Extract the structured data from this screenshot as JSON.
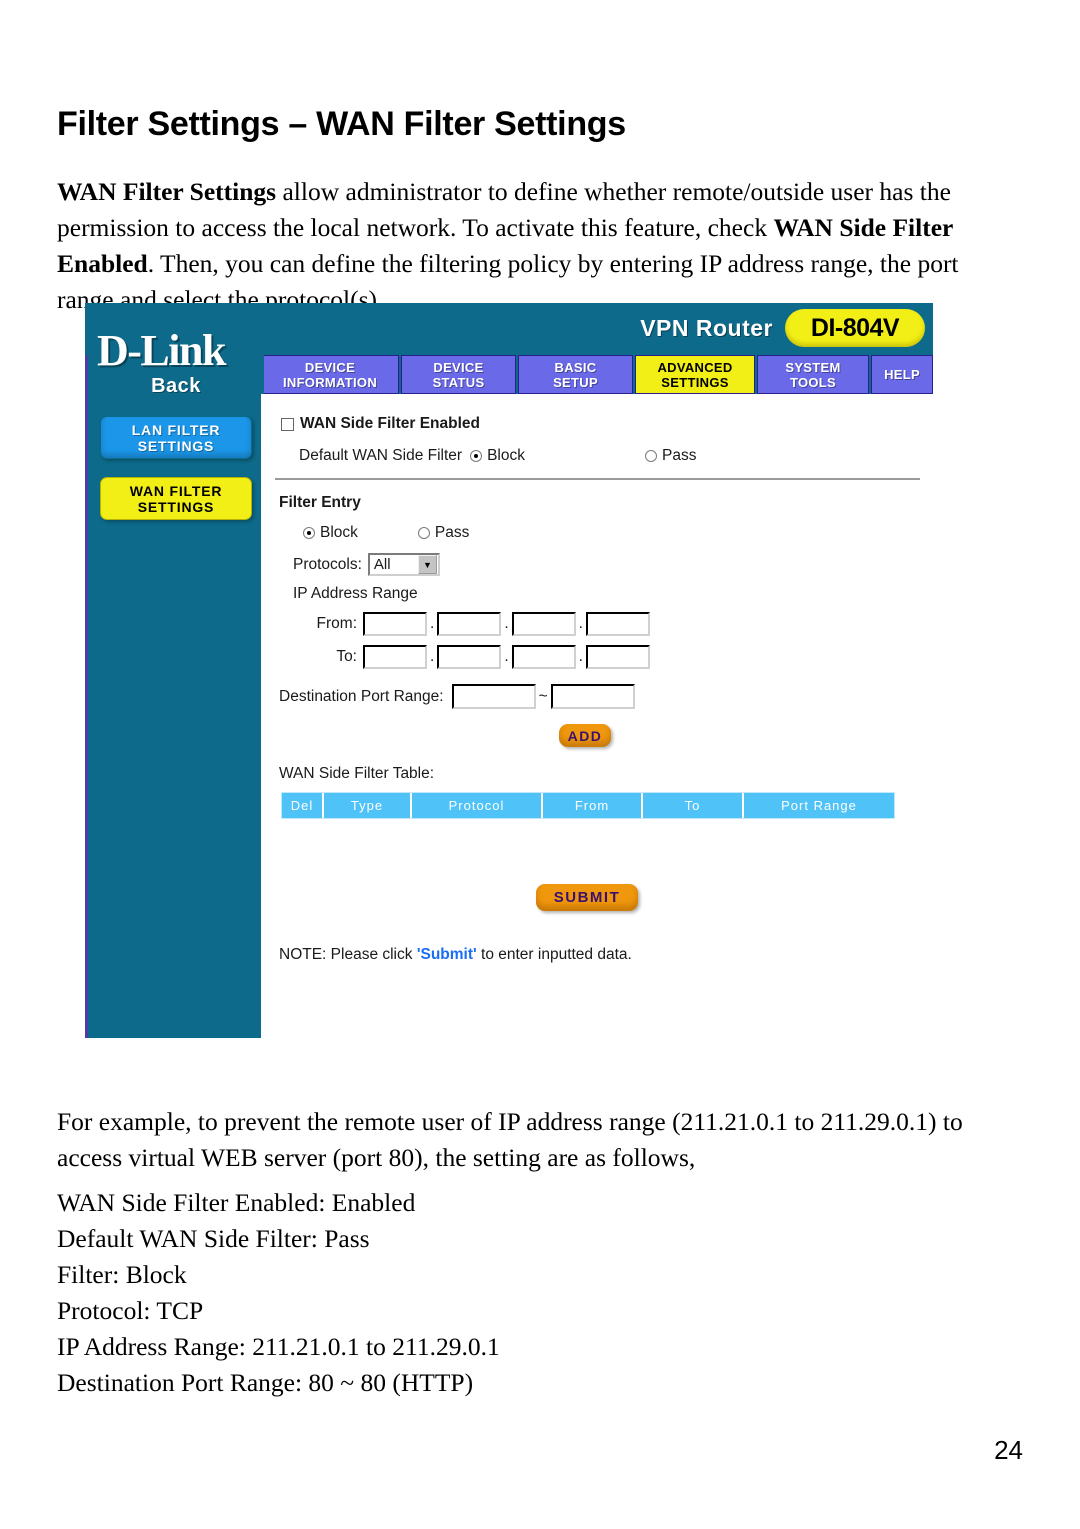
{
  "document": {
    "title": "Filter Settings – WAN Filter Settings",
    "intro": {
      "bold1": "WAN Filter Settings",
      "text1": " allow administrator to define whether remote/outside user has the permission to access the local network. To activate this feature, check ",
      "bold2": "WAN Side Filter Enabled",
      "text2": ". Then, you can define the filtering policy by entering IP address range, the port range and select the protocol(s)."
    },
    "example_paragraph": "For example, to prevent the remote user of IP address range (211.21.0.1 to 211.29.0.1) to access virtual WEB server (port 80), the setting are as follows,",
    "settings_summary": [
      "WAN Side Filter Enabled: Enabled",
      "Default WAN Side Filter: Pass",
      "Filter: Block",
      "Protocol: TCP",
      "IP Address Range: 211.21.0.1 to 211.29.0.1",
      "Destination Port Range: 80 ~ 80 (HTTP)"
    ],
    "page_number": "24"
  },
  "router_ui": {
    "header": {
      "brand": "D-Link",
      "product_label": "VPN Router",
      "model": "DI-804V"
    },
    "nav_tabs": [
      {
        "line1": "DEVICE",
        "line2": "INFORMATION",
        "active": false
      },
      {
        "line1": "DEVICE",
        "line2": "STATUS",
        "active": false
      },
      {
        "line1": "BASIC",
        "line2": "SETUP",
        "active": false
      },
      {
        "line1": "ADVANCED",
        "line2": "SETTINGS",
        "active": true
      },
      {
        "line1": "SYSTEM",
        "line2": "TOOLS",
        "active": false
      },
      {
        "line1": "HELP",
        "line2": "",
        "active": false
      }
    ],
    "sidebar": {
      "back_label": "Back",
      "buttons": [
        {
          "line1": "LAN FILTER",
          "line2": "SETTINGS",
          "style": "blue"
        },
        {
          "line1": "WAN FILTER",
          "line2": "SETTINGS",
          "style": "yellow"
        }
      ]
    },
    "form": {
      "enable_checkbox_label": "WAN Side Filter Enabled",
      "enable_checkbox_checked": false,
      "default_filter_label": "Default WAN Side Filter",
      "default_filter_block": "Block",
      "default_filter_pass": "Pass",
      "default_filter_selected": "Block",
      "filter_entry_title": "Filter Entry",
      "entry_block": "Block",
      "entry_pass": "Pass",
      "entry_selected": "Block",
      "protocols_label": "Protocols:",
      "protocols_value": "All",
      "ip_range_label": "IP Address Range",
      "from_label": "From:",
      "to_label": "To:",
      "from_octets": [
        "",
        "",
        "",
        ""
      ],
      "to_octets": [
        "",
        "",
        "",
        ""
      ],
      "dot": ".",
      "port_range_label": "Destination Port Range:",
      "port_from": "",
      "port_to": "",
      "port_separator": "~",
      "add_button": "ADD",
      "table_caption": "WAN Side Filter Table:",
      "table_headers": [
        "Del",
        "Type",
        "Protocol",
        "From",
        "To",
        "Port Range"
      ],
      "table_rows": [],
      "submit_button": "SUBMIT",
      "note_prefix": "NOTE: Please click ",
      "note_highlight": "'Submit'",
      "note_suffix": " to enter inputted data."
    },
    "colors": {
      "panel_teal": "#0d6a8a",
      "tab_blue": "#6a6ae8",
      "tab_active_yellow": "#f2ef16",
      "button_orange": "#f0980d",
      "button_text_purple": "#3b1070",
      "table_header_blue": "#4fc3f7",
      "link_blue": "#1a6ef5"
    }
  }
}
